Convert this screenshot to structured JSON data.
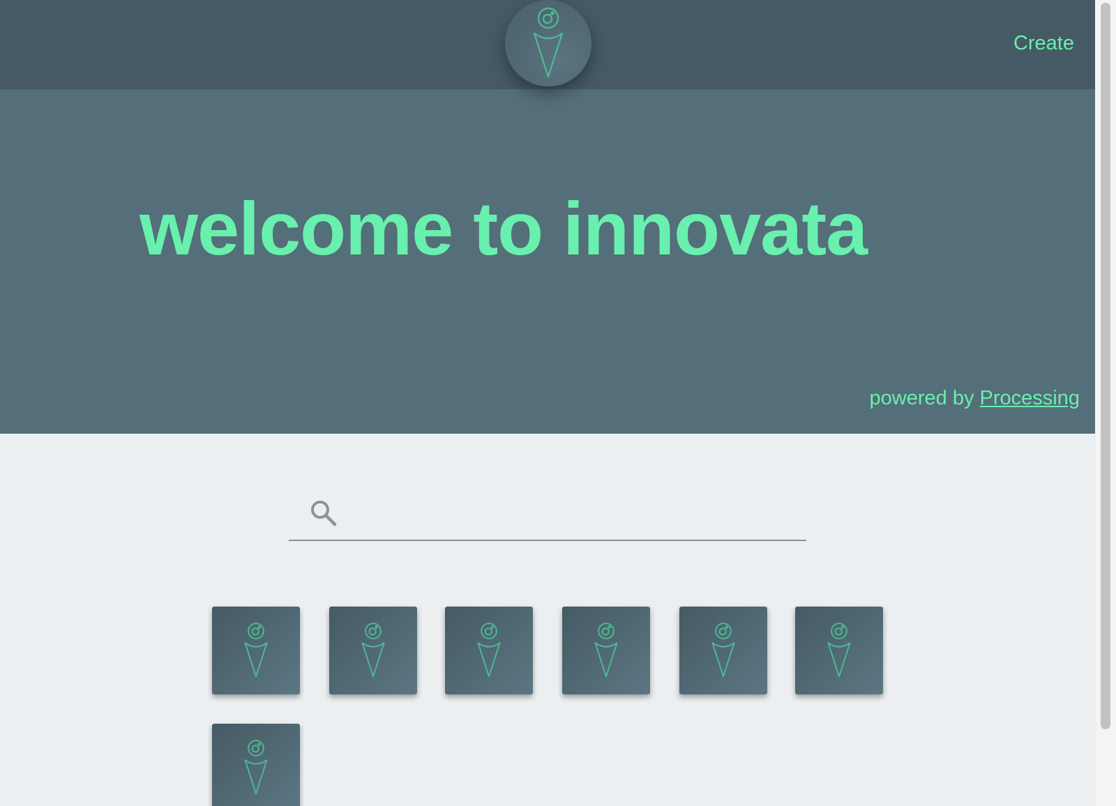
{
  "header": {
    "logo_icon": "innovata-cone-logo-icon",
    "create_label": "Create"
  },
  "hero": {
    "title": "welcome to innovata",
    "powered_prefix": "powered by ",
    "powered_link": "Processing"
  },
  "search": {
    "icon": "search-icon",
    "value": "",
    "placeholder": ""
  },
  "sketches": [
    {
      "icon": "innovata-cone-logo-icon"
    },
    {
      "icon": "innovata-cone-logo-icon"
    },
    {
      "icon": "innovata-cone-logo-icon"
    },
    {
      "icon": "innovata-cone-logo-icon"
    },
    {
      "icon": "innovata-cone-logo-icon"
    },
    {
      "icon": "innovata-cone-logo-icon"
    },
    {
      "icon": "innovata-cone-logo-icon"
    }
  ],
  "colors": {
    "topbar": "#455a64",
    "hero": "#546e7a",
    "accent": "#69f0ae",
    "background": "#eceff1"
  }
}
